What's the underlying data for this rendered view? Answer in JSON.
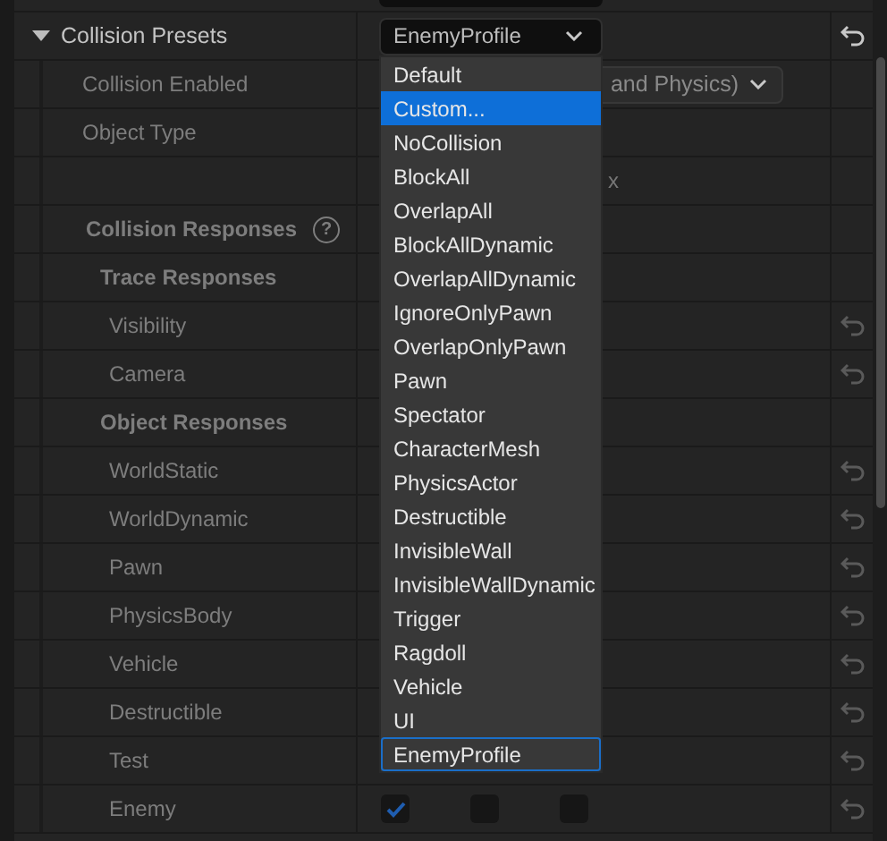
{
  "rows": [
    {
      "kind": "header",
      "label": "Collision Presets",
      "expanded": true,
      "dropdown": {
        "value": "EnemyProfile"
      },
      "reset": true,
      "reset_enabled": true
    },
    {
      "kind": "prop",
      "label": "Collision Enabled",
      "field": {
        "value": "and Physics)"
      }
    },
    {
      "kind": "prop",
      "label": "Object Type"
    },
    {
      "kind": "blank",
      "value": "x"
    },
    {
      "kind": "section",
      "label": "Collision Responses",
      "help": "?"
    },
    {
      "kind": "group",
      "label": "Trace Responses"
    },
    {
      "kind": "channel",
      "label": "Visibility",
      "reset": true,
      "reset_enabled": false
    },
    {
      "kind": "channel",
      "label": "Camera",
      "reset": true,
      "reset_enabled": false
    },
    {
      "kind": "group",
      "label": "Object Responses"
    },
    {
      "kind": "channel",
      "label": "WorldStatic",
      "reset": true,
      "reset_enabled": false
    },
    {
      "kind": "channel",
      "label": "WorldDynamic",
      "reset": true,
      "reset_enabled": false
    },
    {
      "kind": "channel",
      "label": "Pawn",
      "reset": true,
      "reset_enabled": false
    },
    {
      "kind": "channel",
      "label": "PhysicsBody",
      "reset": true,
      "reset_enabled": false
    },
    {
      "kind": "channel",
      "label": "Vehicle",
      "reset": true,
      "reset_enabled": false
    },
    {
      "kind": "channel",
      "label": "Destructible",
      "reset": true,
      "reset_enabled": false
    },
    {
      "kind": "channel",
      "label": "Test",
      "reset": true,
      "reset_enabled": false
    },
    {
      "kind": "channel",
      "label": "Enemy",
      "checks": [
        {
          "checked": true
        },
        {
          "checked": false
        },
        {
          "checked": false
        }
      ],
      "reset": true,
      "reset_enabled": false
    }
  ],
  "menu": {
    "items": [
      {
        "label": "Default",
        "selected": false,
        "focused": false
      },
      {
        "label": "Custom...",
        "selected": true,
        "focused": false
      },
      {
        "label": "NoCollision",
        "selected": false,
        "focused": false
      },
      {
        "label": "BlockAll",
        "selected": false,
        "focused": false
      },
      {
        "label": "OverlapAll",
        "selected": false,
        "focused": false
      },
      {
        "label": "BlockAllDynamic",
        "selected": false,
        "focused": false
      },
      {
        "label": "OverlapAllDynamic",
        "selected": false,
        "focused": false
      },
      {
        "label": "IgnoreOnlyPawn",
        "selected": false,
        "focused": false
      },
      {
        "label": "OverlapOnlyPawn",
        "selected": false,
        "focused": false
      },
      {
        "label": "Pawn",
        "selected": false,
        "focused": false
      },
      {
        "label": "Spectator",
        "selected": false,
        "focused": false
      },
      {
        "label": "CharacterMesh",
        "selected": false,
        "focused": false
      },
      {
        "label": "PhysicsActor",
        "selected": false,
        "focused": false
      },
      {
        "label": "Destructible",
        "selected": false,
        "focused": false
      },
      {
        "label": "InvisibleWall",
        "selected": false,
        "focused": false
      },
      {
        "label": "InvisibleWallDynamic",
        "selected": false,
        "focused": false
      },
      {
        "label": "Trigger",
        "selected": false,
        "focused": false
      },
      {
        "label": "Ragdoll",
        "selected": false,
        "focused": false
      },
      {
        "label": "Vehicle",
        "selected": false,
        "focused": false
      },
      {
        "label": "UI",
        "selected": false,
        "focused": false
      },
      {
        "label": "EnemyProfile",
        "selected": false,
        "focused": true
      }
    ]
  }
}
